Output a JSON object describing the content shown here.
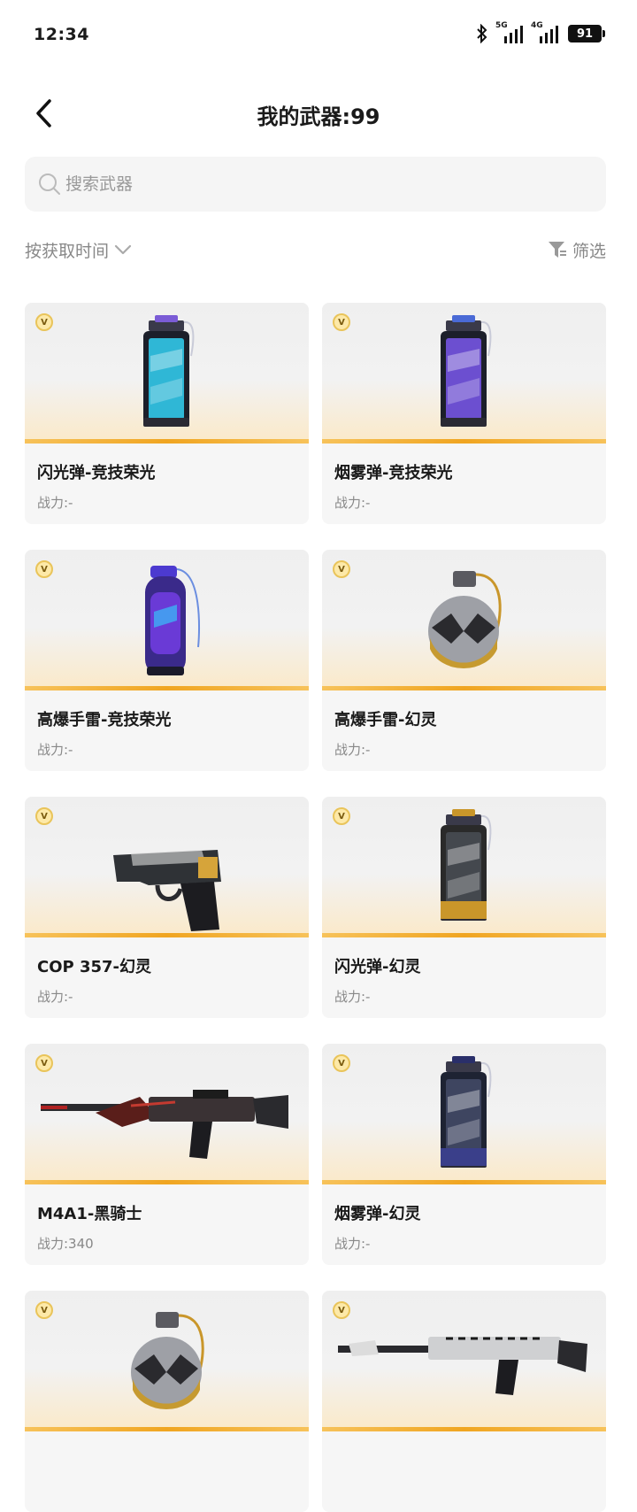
{
  "status_bar": {
    "time": "12:34",
    "network_1": "5G",
    "network_2": "4G",
    "battery": "91"
  },
  "header": {
    "back_icon": "chevron-left-icon",
    "title": "我的武器:99"
  },
  "search": {
    "placeholder": "搜索武器",
    "value": ""
  },
  "toolbar": {
    "sort_label": "按获取时间",
    "filter_label": "筛选"
  },
  "colors": {
    "accent_orange": "#f0a521",
    "card_bg": "#f6f6f6",
    "muted_text": "#888888"
  },
  "weapons": [
    {
      "name": "闪光弹-竞技荣光",
      "power": "战力:-",
      "badge": "V",
      "art": "canister-blue"
    },
    {
      "name": "烟雾弹-竞技荣光",
      "power": "战力:-",
      "badge": "V",
      "art": "canister-purple"
    },
    {
      "name": "高爆手雷-竞技荣光",
      "power": "战力:-",
      "badge": "V",
      "art": "grenade-tall-purple"
    },
    {
      "name": "高爆手雷-幻灵",
      "power": "战力:-",
      "badge": "V",
      "art": "grenade-round-gold"
    },
    {
      "name": "COP 357-幻灵",
      "power": "战力:-",
      "badge": "V",
      "art": "pistol"
    },
    {
      "name": "闪光弹-幻灵",
      "power": "战力:-",
      "badge": "V",
      "art": "canister-gold"
    },
    {
      "name": "M4A1-黑骑士",
      "power": "战力:340",
      "badge": "V",
      "art": "rifle-red"
    },
    {
      "name": "烟雾弹-幻灵",
      "power": "战力:-",
      "badge": "V",
      "art": "canister-navy"
    },
    {
      "name": "",
      "power": "",
      "badge": "V",
      "art": "grenade-round-gold"
    },
    {
      "name": "",
      "power": "",
      "badge": "V",
      "art": "rifle-silver"
    }
  ]
}
